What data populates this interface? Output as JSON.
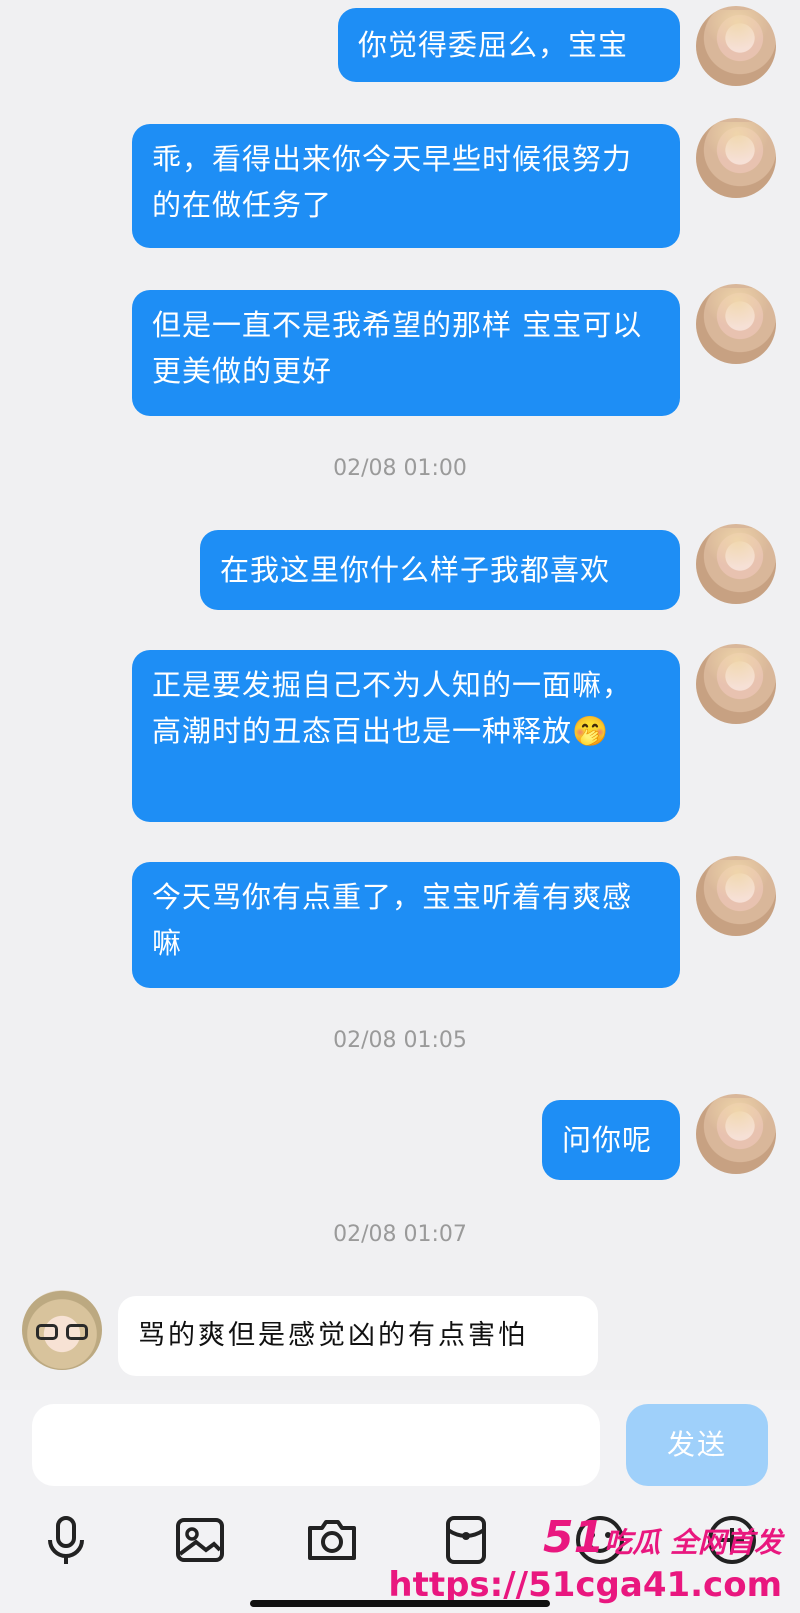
{
  "messages": [
    {
      "text": "你觉得委屈么，宝宝"
    },
    {
      "text": "乖，看得出来你今天早些时候很努力的在做任务了"
    },
    {
      "text": "但是一直不是我希望的那样 宝宝可以更美做的更好"
    },
    {
      "text": "在我这里你什么样子我都喜欢"
    },
    {
      "text": "正是要发掘自己不为人知的一面嘛，高潮时的丑态百出也是一种释放🤭"
    },
    {
      "text": "今天骂你有点重了，宝宝听着有爽感嘛"
    },
    {
      "text": "问你呢"
    },
    {
      "text": "骂的爽但是感觉凶的有点害怕"
    }
  ],
  "timestamps": [
    "02/08 01:00",
    "02/08 01:05",
    "02/08 01:07"
  ],
  "composer": {
    "placeholder": "",
    "send_label": "发送"
  },
  "toolbar": [
    "microphone-icon",
    "image-icon",
    "camera-icon",
    "red-packet-icon",
    "emoji-icon",
    "plus-icon"
  ],
  "watermark": {
    "line1_big": "51",
    "line1": "吃瓜 全网首发",
    "line2": "https://51cga41.com"
  },
  "colors": {
    "bubble_me": "#1e8ef5",
    "bubble_other": "#ffffff",
    "send_button": "#9fd0fa",
    "watermark": "#e9177f"
  }
}
